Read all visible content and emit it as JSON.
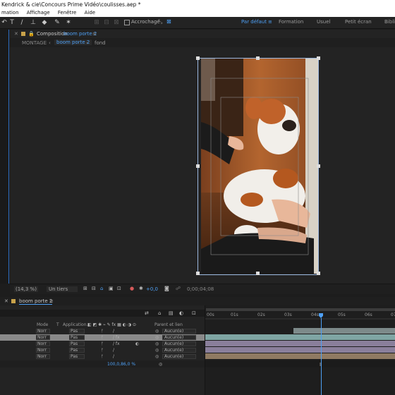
{
  "app": {
    "title": "Kendrick & cie\\Concours Prime Vidéo\\coulisses.aep *"
  },
  "menu": [
    "mation",
    "Affichage",
    "Fenêtre",
    "Aide"
  ],
  "toolbar": {
    "snap_label": "Accrochage"
  },
  "workspaces": [
    "Par défaut",
    "≡",
    "Formation",
    "Usuel",
    "Petit écran",
    "Bibliot"
  ],
  "comp_panel": {
    "label": "Composition",
    "comp_name": "boom porte 2",
    "menu_icon": "≡"
  },
  "comp_nav": {
    "montage": "MONTAGE",
    "crumb_active": "boom porte 2",
    "crumb_next": "fond"
  },
  "comp_footer": {
    "zoom": "(14,3 %)",
    "resolution": "Un tiers",
    "exposure": "+0,0",
    "timecode": "0;00;04;08"
  },
  "timeline": {
    "tab": "boom porte 2",
    "columns": [
      "Mode",
      "T",
      "Application...",
      "Parent et lien"
    ],
    "rows": [
      {
        "mode": "Norr",
        "app": "Pas",
        "parent": "Aucun(e)"
      },
      {
        "mode": "Norr",
        "app": "Pas",
        "parent": "Aucun(e)"
      },
      {
        "mode": "Norr",
        "app": "Pas",
        "parent": "Aucun(e)"
      },
      {
        "mode": "Norr",
        "app": "Pas",
        "parent": "Aucun(e)"
      },
      {
        "mode": "Norr",
        "app": "Pas",
        "parent": "Aucun(e)"
      }
    ],
    "scale_value": "100,0,86,0 %",
    "ruler": [
      "00s",
      "01s",
      "02s",
      "03s",
      "04s",
      "05s",
      "06s",
      "07"
    ]
  },
  "colors": {
    "accent": "#4ea0f5",
    "panel_bg": "#1d1d1d",
    "selection": "#2e6cc1"
  }
}
